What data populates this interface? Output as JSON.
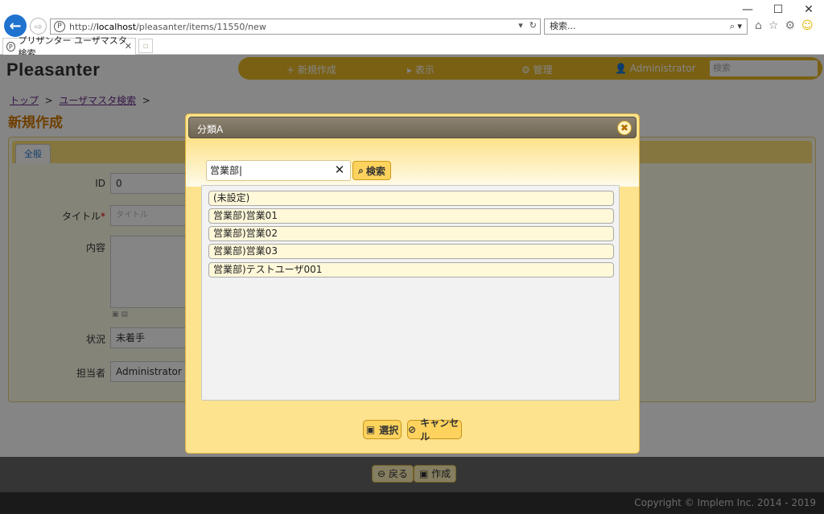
{
  "browser": {
    "url_prefix": "http://",
    "url_host": "localhost",
    "url_path": "/pleasanter/items/11550/new",
    "search_placeholder": "検索...",
    "tab_title": "プリザンター ユーザマスタ検索 ..."
  },
  "app": {
    "logo": "Pleasanter",
    "nav": {
      "new": "新規作成",
      "view": "表示",
      "manage": "管理",
      "user": "Administrator",
      "search_placeholder": "検索"
    },
    "breadcrumb": [
      "トップ",
      "ユーザマスタ検索"
    ],
    "page_title": "新規作成",
    "editor_tab": "全般",
    "fields": {
      "id_label": "ID",
      "id_value": "0",
      "title_label": "タイトル",
      "title_placeholder": "タイトル",
      "body_label": "内容",
      "status_label": "状況",
      "status_value": "未着手",
      "manager_label": "担当者",
      "manager_value": "Administrator"
    },
    "footer_buttons": {
      "back": "戻る",
      "create": "作成"
    },
    "copyright": "Copyright © Implem Inc. 2014 - 2019"
  },
  "dialog": {
    "title": "分類A",
    "search_value": "営業部",
    "search_button": "検索",
    "items": [
      "(未設定)",
      "営業部)営業01",
      "営業部)営業02",
      "営業部)営業03",
      "営業部)テストユーザ001"
    ],
    "select_button": "選択",
    "cancel_button": "キャンセル"
  }
}
